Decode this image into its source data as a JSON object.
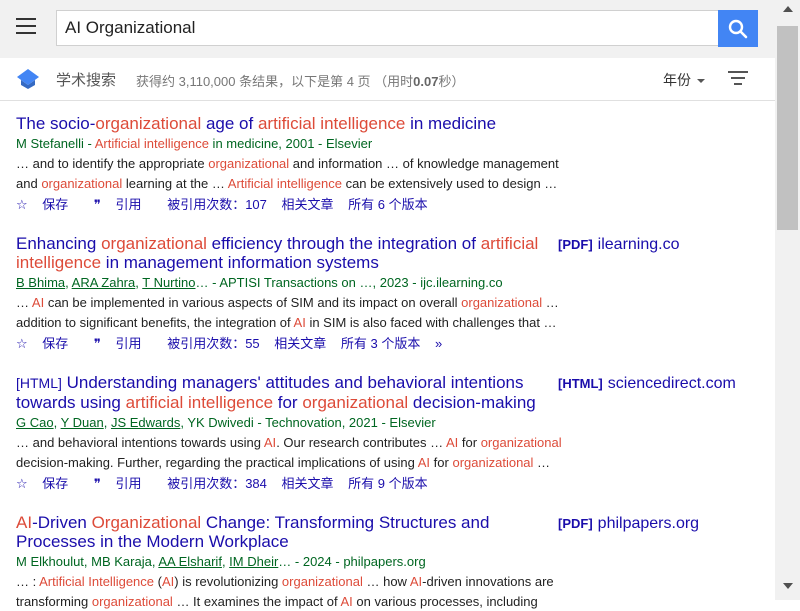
{
  "search": {
    "value": "AI Organizational"
  },
  "subbar": {
    "brand": "学术搜索",
    "stats_prefix": "获得约 3,110,000 条结果，以下是第 4 页 （用时",
    "stats_time": "0.07",
    "stats_suffix": "秒）",
    "year_label": "年份"
  },
  "colors": {
    "accent": "#4285f4",
    "link": "#1a0dab",
    "highlight": "#dd4b39",
    "authors": "#006621"
  },
  "results": [
    {
      "tag": "",
      "title_parts": [
        "The socio-",
        "organizational",
        " age of ",
        "artificial intelligence",
        " in medicine"
      ],
      "authors_parts": [
        "M Stefanelli - ",
        "Artificial intelligence",
        " in medicine, 2001 - Elsevier"
      ],
      "snippet1_parts": [
        "… and to identify the appropriate ",
        "organizational",
        " and information … of knowledge management"
      ],
      "snippet2_parts": [
        "and ",
        "organizational",
        " learning at the … ",
        "Artificial intelligence",
        " can be extensively used to design …"
      ],
      "save": "保存",
      "cite": "引用",
      "cited_by": "被引用次数：107",
      "related": "相关文章",
      "versions": "所有 6 个版本"
    },
    {
      "tag": "",
      "title_parts": [
        "Enhancing ",
        "organizational",
        " efficiency through the integration of ",
        "artificial intelligence",
        " in management information systems"
      ],
      "authors_parts": [
        "B Bhima",
        ", ",
        "ARA Zahra",
        ", ",
        "T Nurtino",
        "… - APTISI Transactions on …, 2023 - ijc.ilearning.co"
      ],
      "snippet1_parts": [
        "… ",
        "AI",
        " can be implemented in various aspects of SIM and its impact on overall ",
        "organizational",
        " …"
      ],
      "snippet2_parts": [
        "addition to significant benefits, the integration of ",
        "AI",
        " in SIM is also faced with challenges that …"
      ],
      "save": "保存",
      "cite": "引用",
      "cited_by": "被引用次数：55",
      "related": "相关文章",
      "versions": "所有 3 个版本",
      "side_tag": "[PDF]",
      "side_source": "ilearning.co"
    },
    {
      "tag": "[HTML]",
      "title_parts": [
        " Understanding managers' attitudes and behavioral intentions towards using ",
        "artificial intelligence",
        " for ",
        "organizational",
        " decision-making"
      ],
      "authors_parts": [
        "G Cao",
        ", ",
        "Y Duan",
        ", ",
        "JS Edwards",
        ", YK Dwivedi - Technovation, 2021 - Elsevier"
      ],
      "snippet1_parts": [
        "… and behavioral intentions towards using ",
        "AI",
        ". Our research contributes … ",
        "AI",
        " for ",
        "organizational"
      ],
      "snippet2_parts": [
        "decision-making. Further, regarding the practical implications of using ",
        "AI",
        " for ",
        "organizational",
        " …"
      ],
      "save": "保存",
      "cite": "引用",
      "cited_by": "被引用次数：384",
      "related": "相关文章",
      "versions": "所有 9 个版本",
      "side_tag": "[HTML]",
      "side_source": "sciencedirect.com"
    },
    {
      "tag": "",
      "title_parts": [
        "AI",
        "-Driven ",
        "Organizational",
        " Change: Transforming Structures and Processes in the Modern Workplace"
      ],
      "authors_parts": [
        "M Elkhoulut, MB Karaja, ",
        "AA Elsharif",
        ", ",
        "IM Dheir",
        "… - 2024 - philpapers.org"
      ],
      "snippet1_parts": [
        "… : ",
        "Artificial Intelligence",
        " (",
        "AI",
        ") is revolutionizing ",
        "organizational",
        " … how ",
        "AI",
        "-driven innovations are"
      ],
      "snippet2_parts": [
        "transforming ",
        "organizational",
        " … It examines the impact of ",
        "AI",
        " on various processes, including"
      ],
      "side_tag": "[PDF]",
      "side_source": "philpapers.org"
    }
  ]
}
